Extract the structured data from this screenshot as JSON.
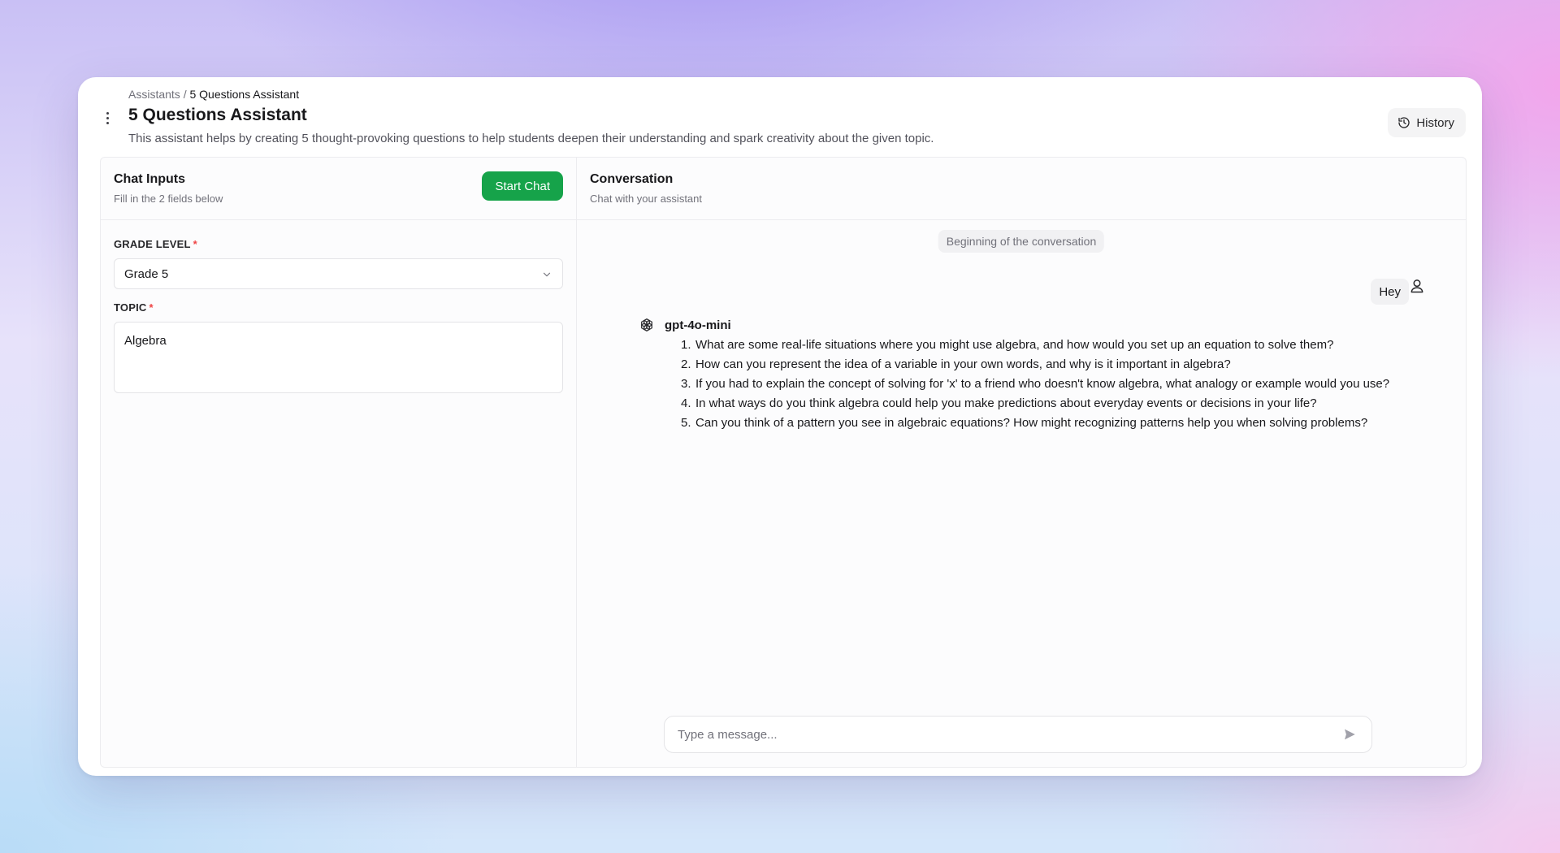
{
  "header": {
    "breadcrumb": {
      "root": "Assistants",
      "separator": "/",
      "current": "5 Questions Assistant"
    },
    "title": "5 Questions Assistant",
    "description": "This assistant helps by creating 5 thought-provoking questions to help students deepen their understanding and spark creativity about the given topic.",
    "history_label": "History"
  },
  "inputs_panel": {
    "title": "Chat Inputs",
    "subtitle": "Fill in the 2 fields below",
    "start_label": "Start Chat",
    "grade_level": {
      "label": "GRADE LEVEL",
      "required_mark": "*",
      "value": "Grade 5"
    },
    "topic": {
      "label": "TOPIC",
      "required_mark": "*",
      "value": "Algebra"
    }
  },
  "conversation": {
    "title": "Conversation",
    "subtitle": "Chat with your assistant",
    "start_marker": "Beginning of the conversation",
    "user_message": "Hey",
    "model_name": "gpt-4o-mini",
    "answers": [
      {
        "num": "1.",
        "text": "What are some real-life situations where you might use algebra, and how would you set up an equation to solve them?"
      },
      {
        "num": "2.",
        "text": "How can you represent the idea of a variable in your own words, and why is it important in algebra?"
      },
      {
        "num": "3.",
        "text": "If you had to explain the concept of solving for 'x' to a friend who doesn't know algebra, what analogy or example would you use?"
      },
      {
        "num": "4.",
        "text": "In what ways do you think algebra could help you make predictions about everyday events or decisions in your life?"
      },
      {
        "num": "5.",
        "text": "Can you think of a pattern you see in algebraic equations? How might recognizing patterns help you when solving problems?"
      }
    ],
    "composer_placeholder": "Type a message..."
  },
  "colors": {
    "accent_green": "#16a34a",
    "required_red": "#ef4444"
  },
  "icons": [
    "kebab-menu-icon",
    "history-icon",
    "chevron-down-icon",
    "user-icon",
    "openai-icon",
    "send-icon"
  ]
}
